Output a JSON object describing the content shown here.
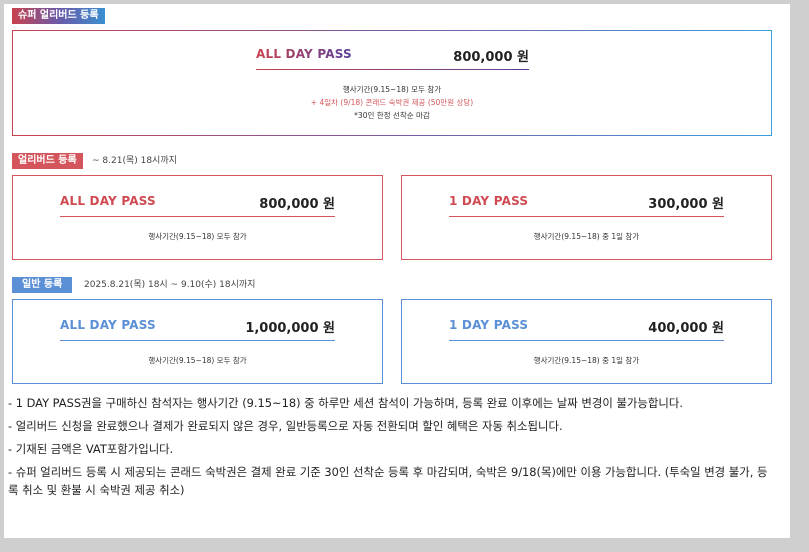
{
  "super_early": {
    "tag": "슈퍼 얼리버드 등록",
    "pass_name": "ALL DAY PASS",
    "price": "800,000 원",
    "line1": "행사기간(9.15~18) 모두 참가",
    "line2": "+ 4일차 (9/18) 콘래드 숙박권 제공 (50만원 상당)",
    "line3": "*30인 한정 선착순 마감"
  },
  "early": {
    "tag": "얼리버드 등록",
    "note": "~ 8.21(목) 18시까지",
    "all_day": {
      "pass_name": "ALL DAY PASS",
      "price": "800,000 원",
      "desc": "행사기간(9.15~18) 모두 참가"
    },
    "one_day": {
      "pass_name": "1 DAY PASS",
      "price": "300,000 원",
      "desc": "행사기간(9.15~18) 중 1일 참가"
    }
  },
  "general": {
    "tag": "일반 등록",
    "note": "2025.8.21(목) 18시 ~ 9.10(수) 18시까지",
    "all_day": {
      "pass_name": "ALL DAY PASS",
      "price": "1,000,000 원",
      "desc": "행사기간(9.15~18) 모두 참가"
    },
    "one_day": {
      "pass_name": "1 DAY PASS",
      "price": "400,000 원",
      "desc": "행사기간(9.15~18) 중 1일 참가"
    }
  },
  "notes": [
    "- 1 DAY PASS권을 구매하신 참석자는 행사기간 (9.15~18) 중 하루만 세션 참석이 가능하며, 등록 완료 이후에는 날짜 변경이 불가능합니다.",
    "- 얼리버드 신청을 완료했으나 결제가 완료되지 않은 경우, 일반등록으로 자동 전환되며 할인 혜택은 자동 취소됩니다.",
    "- 기재된 금액은 VAT포함가입니다.",
    "- 슈퍼 얼리버드 등록 시 제공되는 콘래드 숙박권은 결제 완료 기준 30인 선착순 등록 후 마감되며, 숙박은 9/18(목)에만 이용 가능합니다. (투숙일 변경 불가, 등록 취소 및 환불 시 숙박권 제공 취소)"
  ],
  "colors": {
    "red": "#d4555b",
    "blue": "#5b8fd6",
    "purple": "#5a3f9a"
  }
}
